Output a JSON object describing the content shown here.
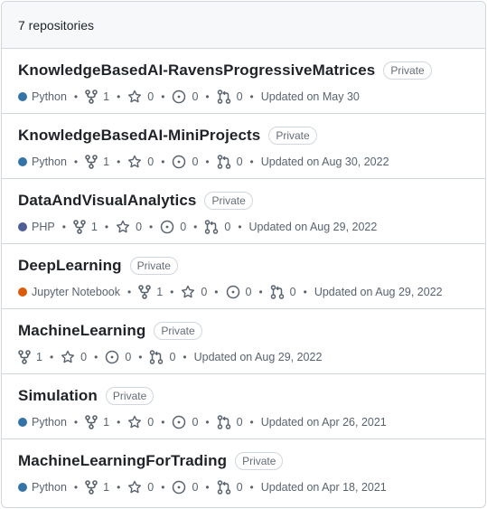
{
  "header": {
    "count_label": "7 repositories"
  },
  "separator": "•",
  "repos": [
    {
      "name": "KnowledgeBasedAI-RavensProgressiveMatrices",
      "visibility": "Private",
      "language": "Python",
      "language_color": "#3572A5",
      "forks": "1",
      "stars": "0",
      "issues": "0",
      "prs": "0",
      "updated": "Updated on May 30"
    },
    {
      "name": "KnowledgeBasedAI-MiniProjects",
      "visibility": "Private",
      "language": "Python",
      "language_color": "#3572A5",
      "forks": "1",
      "stars": "0",
      "issues": "0",
      "prs": "0",
      "updated": "Updated on Aug 30, 2022"
    },
    {
      "name": "DataAndVisualAnalytics",
      "visibility": "Private",
      "language": "PHP",
      "language_color": "#4F5D95",
      "forks": "1",
      "stars": "0",
      "issues": "0",
      "prs": "0",
      "updated": "Updated on Aug 29, 2022"
    },
    {
      "name": "DeepLearning",
      "visibility": "Private",
      "language": "Jupyter Notebook",
      "language_color": "#DA5B0B",
      "forks": "1",
      "stars": "0",
      "issues": "0",
      "prs": "0",
      "updated": "Updated on Aug 29, 2022"
    },
    {
      "name": "MachineLearning",
      "visibility": "Private",
      "language": "",
      "language_color": "",
      "forks": "1",
      "stars": "0",
      "issues": "0",
      "prs": "0",
      "updated": "Updated on Aug 29, 2022"
    },
    {
      "name": "Simulation",
      "visibility": "Private",
      "language": "Python",
      "language_color": "#3572A5",
      "forks": "1",
      "stars": "0",
      "issues": "0",
      "prs": "0",
      "updated": "Updated on Apr 26, 2021"
    },
    {
      "name": "MachineLearningForTrading",
      "visibility": "Private",
      "language": "Python",
      "language_color": "#3572A5",
      "forks": "1",
      "stars": "0",
      "issues": "0",
      "prs": "0",
      "updated": "Updated on Apr 18, 2021"
    }
  ]
}
